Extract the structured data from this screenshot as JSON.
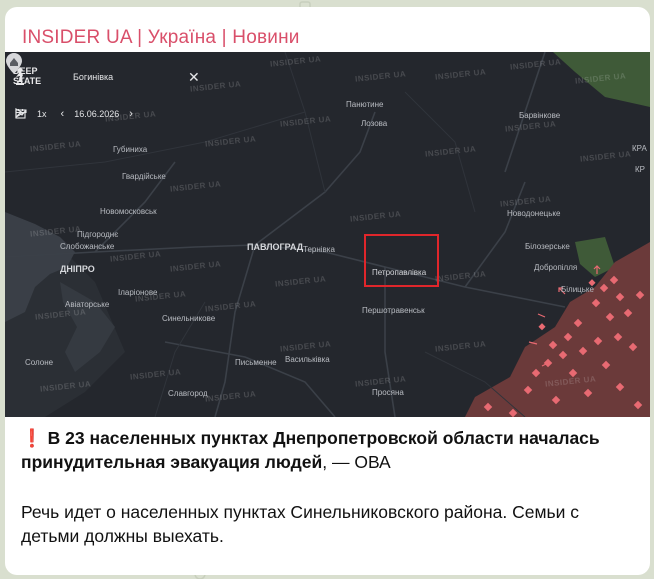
{
  "channel": {
    "title": "INSIDER UA | Україна | Новини"
  },
  "map": {
    "brand_line1": "DEEP",
    "brand_line2": "STATE",
    "search_value": "Богинівка",
    "speed": "1x",
    "date": "16.06.2026",
    "highlight_color": "#e0262b",
    "occupied_color": "#6b3a3a",
    "controlled_color": "#3f5a38",
    "watermark": "INSIDER UA",
    "places": {
      "pavlohrad": "ПАВЛОГРАД",
      "dnipro": "ДНІПРО",
      "petropavlivka": "Петропавлівка",
      "ternivka": "Тернівка",
      "panyutyne": "Панютине",
      "lozova": "Лозова",
      "barvinkove": "Барвінкове",
      "hubynykha": "Губиниха",
      "hvardiiske": "Гвардійське",
      "novomoskovsk": "Новомосковськ",
      "pidhorodne": "Підгороднє",
      "slobozhanske": "Слобожанське",
      "ilarionove": "Іларіонове",
      "aviatorske": "Авіаторське",
      "synelnykove": "Синельникове",
      "pershotravensk": "Першотравенськ",
      "novodonetske": "Новодонецьке",
      "bilozerske": "Білозерське",
      "dobropillia": "Добропілля",
      "bilytske": "Білицьке",
      "solone": "Солоне",
      "pysmenne": "Письменне",
      "vasylkivka": "Васильківка",
      "slavhorod": "Славгород",
      "prosiana": "Просяна",
      "kra": "КРА",
      "kr": "КР"
    }
  },
  "message": {
    "emoji": "❗",
    "headline": "В 23 населенных пунктах Днепропетровской области началась принудительная эвакуация людей",
    "source": ", — ОВА",
    "body": "Речь идет о населенных пунктах Синельниковского района. Семьи с детьми должны выехать."
  }
}
